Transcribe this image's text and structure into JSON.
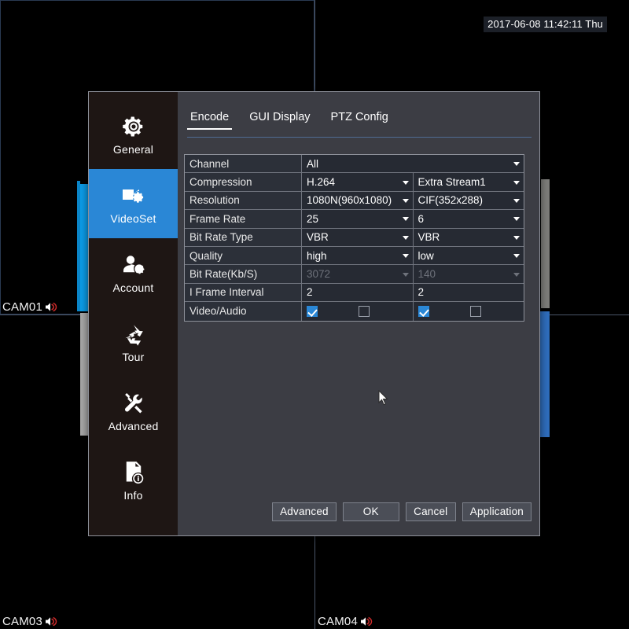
{
  "live_view": {
    "osd_timestamp": "2017-06-08 11:42:11 Thu",
    "cameras": [
      {
        "label": "CAM01",
        "audio_icon": "speaker-mute-icon"
      },
      {
        "label": "CAM03",
        "audio_icon": "speaker-mute-icon"
      },
      {
        "label": "CAM04",
        "audio_icon": "speaker-mute-icon"
      }
    ],
    "accent_blue": "#0c9ce8",
    "accent_gray": "#a8a8a8"
  },
  "dialog": {
    "background": "#3c3d44",
    "sidebar_background": "#1e1614",
    "active_color": "#2a87d6",
    "sidebar": {
      "items": [
        {
          "label": "General",
          "icon": "gear-icon",
          "active": false
        },
        {
          "label": "VideoSet",
          "icon": "video-camera-gear-icon",
          "active": true
        },
        {
          "label": "Account",
          "icon": "user-gear-icon",
          "active": false
        },
        {
          "label": "Tour",
          "icon": "recycle-icon",
          "active": false
        },
        {
          "label": "Advanced",
          "icon": "tools-icon",
          "active": false
        },
        {
          "label": "Info",
          "icon": "document-info-icon",
          "active": false
        }
      ]
    },
    "tabs": [
      {
        "label": "Encode",
        "active": true
      },
      {
        "label": "GUI Display",
        "active": false
      },
      {
        "label": "PTZ Config",
        "active": false
      }
    ],
    "table": {
      "rows": [
        {
          "label": "Channel",
          "type": "select-span",
          "main": {
            "value": "All",
            "disabled": false
          }
        },
        {
          "label": "Compression",
          "type": "select",
          "main": {
            "value": "H.264",
            "disabled": false
          },
          "extra": {
            "value": "Extra Stream1",
            "disabled": false
          }
        },
        {
          "label": "Resolution",
          "type": "select",
          "main": {
            "value": "1080N(960x1080)",
            "disabled": false
          },
          "extra": {
            "value": "CIF(352x288)",
            "disabled": false
          }
        },
        {
          "label": "Frame Rate",
          "type": "select",
          "main": {
            "value": "25",
            "disabled": false
          },
          "extra": {
            "value": "6",
            "disabled": false
          }
        },
        {
          "label": "Bit Rate Type",
          "type": "select",
          "main": {
            "value": "VBR",
            "disabled": false
          },
          "extra": {
            "value": "VBR",
            "disabled": false
          }
        },
        {
          "label": "Quality",
          "type": "select",
          "main": {
            "value": "high",
            "disabled": false
          },
          "extra": {
            "value": "low",
            "disabled": false
          }
        },
        {
          "label": "Bit Rate(Kb/S)",
          "type": "select",
          "main": {
            "value": "3072",
            "disabled": true
          },
          "extra": {
            "value": "140",
            "disabled": true
          }
        },
        {
          "label": "I Frame Interval",
          "type": "text",
          "main": {
            "value": "2",
            "disabled": false
          },
          "extra": {
            "value": "2",
            "disabled": false
          }
        },
        {
          "label": "Video/Audio",
          "type": "checkbox",
          "main": {
            "video_checked": true,
            "audio_checked": false
          },
          "extra": {
            "video_checked": true,
            "audio_checked": false
          }
        }
      ]
    },
    "buttons": [
      {
        "label": "Advanced"
      },
      {
        "label": "OK"
      },
      {
        "label": "Cancel"
      },
      {
        "label": "Application"
      }
    ]
  }
}
